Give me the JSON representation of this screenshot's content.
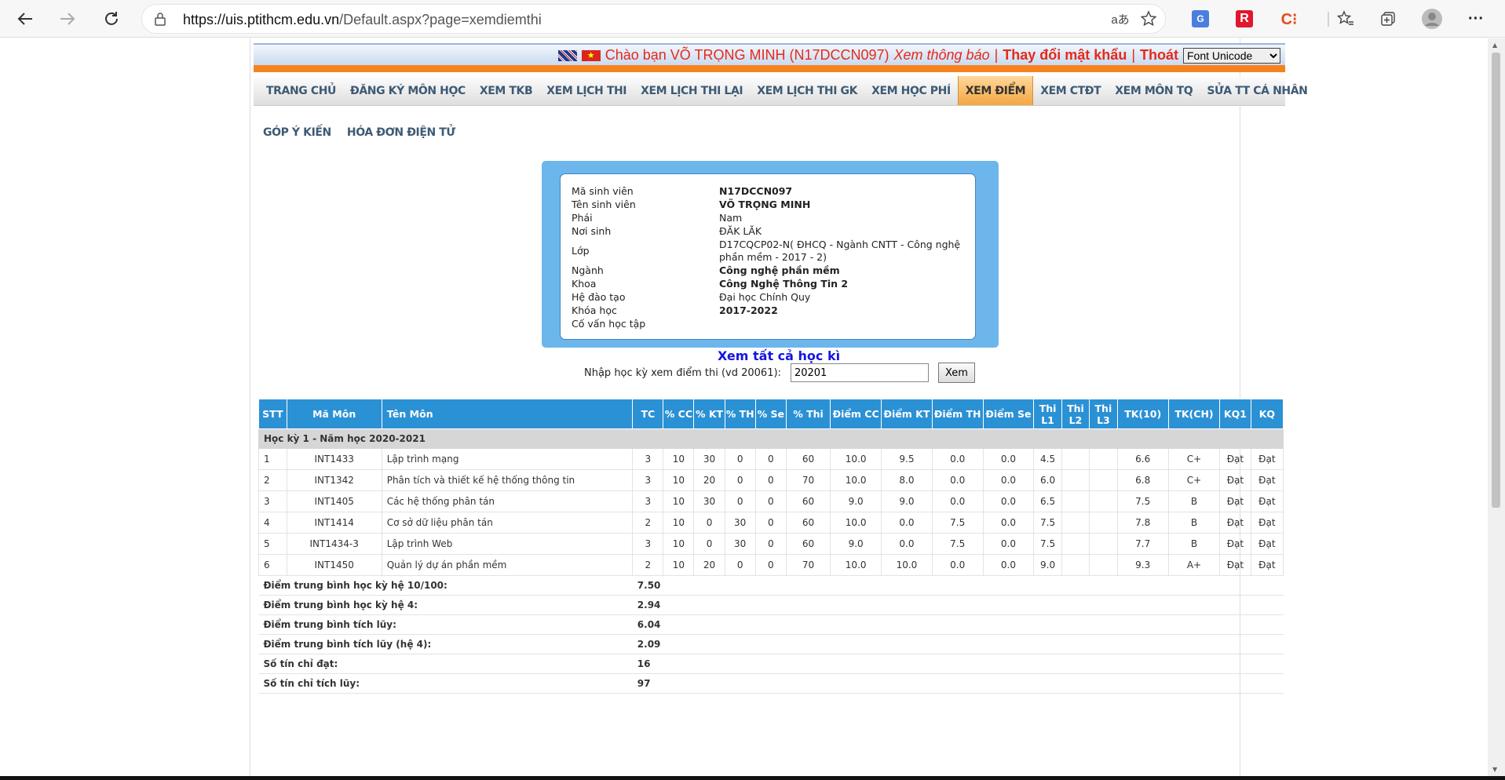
{
  "browser": {
    "url_prefix": "https://uis.ptithcm.edu.vn",
    "url_path": "/Default.aspx?page=xemdiemthi"
  },
  "topbar": {
    "greeting": "Chào bạn VÕ TRỌNG MINH (N17DCCN097)",
    "notice": "Xem thông báo",
    "sep1": "|",
    "change_password": "Thay đổi mật khẩu",
    "sep2": "|",
    "logout": "Thoát",
    "font_select": "Font Unicode"
  },
  "nav": [
    {
      "label": "TRANG CHỦ"
    },
    {
      "label": "ĐĂNG KÝ MÔN HỌC"
    },
    {
      "label": "XEM TKB"
    },
    {
      "label": "XEM LỊCH THI"
    },
    {
      "label": "XEM LỊCH THI LẠI"
    },
    {
      "label": "XEM LỊCH THI GK"
    },
    {
      "label": "XEM HỌC PHÍ"
    },
    {
      "label": "XEM ĐIỂM"
    },
    {
      "label": "XEM CTĐT"
    },
    {
      "label": "XEM MÔN TQ"
    },
    {
      "label": "SỬA TT CÁ NHÂN"
    }
  ],
  "nav2": [
    {
      "label": "GÓP Ý KIẾN"
    },
    {
      "label": "HÓA ĐƠN ĐIỆN TỬ"
    }
  ],
  "student": {
    "labels": {
      "id": "Mã sinh viên",
      "name": "Tên sinh viên",
      "gender": "Phái",
      "birthplace": "Nơi sinh",
      "class": "Lớp",
      "major": "Ngành",
      "faculty": "Khoa",
      "program": "Hệ đào tạo",
      "cohort": "Khóa học",
      "advisor": "Cố vấn học tập"
    },
    "values": {
      "id": "N17DCCN097",
      "name": "VÕ TRỌNG MINH",
      "gender": "Nam",
      "birthplace": "ĐĂK LĂK",
      "class": "D17CQCP02-N( ĐHCQ - Ngành CNTT - Công nghệ phần mềm - 2017 - 2)",
      "major": "Công nghệ phần mềm",
      "faculty": "Công Nghệ Thông Tin 2",
      "program": "Đại học Chính Quy",
      "cohort": "2017-2022",
      "advisor": ""
    }
  },
  "semester_query": {
    "view_all": "Xem tất cả học kì",
    "label": "Nhập học kỳ xem điểm thi (vd 20061):",
    "value": "20201",
    "button": "Xem"
  },
  "grades": {
    "headers": [
      "STT",
      "Mã Môn",
      "Tên Môn",
      "TC",
      "% CC",
      "% KT",
      "% TH",
      "% Se",
      "% Thi",
      "Điểm CC",
      "Điểm KT",
      "Điểm TH",
      "Điểm Se",
      "Thi L1",
      "Thi L2",
      "Thi L3",
      "TK(10)",
      "TK(CH)",
      "KQ1",
      "KQ"
    ],
    "semester_title": "Học kỳ 1 - Năm học 2020-2021",
    "rows": [
      [
        "1",
        "INT1433",
        "Lập trình mạng",
        "3",
        "10",
        "30",
        "0",
        "0",
        "60",
        "10.0",
        "9.5",
        "0.0",
        "0.0",
        "4.5",
        "",
        "",
        "6.6",
        "C+",
        "Đạt",
        "Đạt"
      ],
      [
        "2",
        "INT1342",
        "Phân tích và thiết kế hệ thống thông tin",
        "3",
        "10",
        "20",
        "0",
        "0",
        "70",
        "10.0",
        "8.0",
        "0.0",
        "0.0",
        "6.0",
        "",
        "",
        "6.8",
        "C+",
        "Đạt",
        "Đạt"
      ],
      [
        "3",
        "INT1405",
        "Các hệ thống phân tán",
        "3",
        "10",
        "30",
        "0",
        "0",
        "60",
        "9.0",
        "9.0",
        "0.0",
        "0.0",
        "6.5",
        "",
        "",
        "7.5",
        "B",
        "Đạt",
        "Đạt"
      ],
      [
        "4",
        "INT1414",
        "Cơ sở dữ liệu phân tán",
        "2",
        "10",
        "0",
        "30",
        "0",
        "60",
        "10.0",
        "0.0",
        "7.5",
        "0.0",
        "7.5",
        "",
        "",
        "7.8",
        "B",
        "Đạt",
        "Đạt"
      ],
      [
        "5",
        "INT1434-3",
        "Lập trình Web",
        "3",
        "10",
        "0",
        "30",
        "0",
        "60",
        "9.0",
        "0.0",
        "7.5",
        "0.0",
        "7.5",
        "",
        "",
        "7.7",
        "B",
        "Đạt",
        "Đạt"
      ],
      [
        "6",
        "INT1450",
        "Quản lý dự án phần mềm",
        "2",
        "10",
        "20",
        "0",
        "0",
        "70",
        "10.0",
        "10.0",
        "0.0",
        "0.0",
        "9.0",
        "",
        "",
        "9.3",
        "A+",
        "Đạt",
        "Đạt"
      ]
    ],
    "summary": [
      {
        "label": "Điểm trung bình học kỳ hệ 10/100:",
        "value": "7.50"
      },
      {
        "label": "Điểm trung bình học kỳ hệ 4:",
        "value": "2.94"
      },
      {
        "label": "Điểm trung bình tích lũy:",
        "value": "6.04"
      },
      {
        "label": "Điểm trung bình tích lũy (hệ 4):",
        "value": "2.09"
      },
      {
        "label": "Số tín chỉ đạt:",
        "value": "16"
      },
      {
        "label": "Số tín chỉ tích lũy:",
        "value": "97"
      }
    ]
  },
  "icons": [
    "back-arrow-icon",
    "forward-arrow-icon",
    "reload-icon",
    "lock-icon",
    "read-aloud-icon",
    "add-favorite-icon",
    "translate-icon",
    "r-extension-icon",
    "c-extension-icon",
    "favorites-icon",
    "collections-icon",
    "profile-icon",
    "more-icon"
  ]
}
